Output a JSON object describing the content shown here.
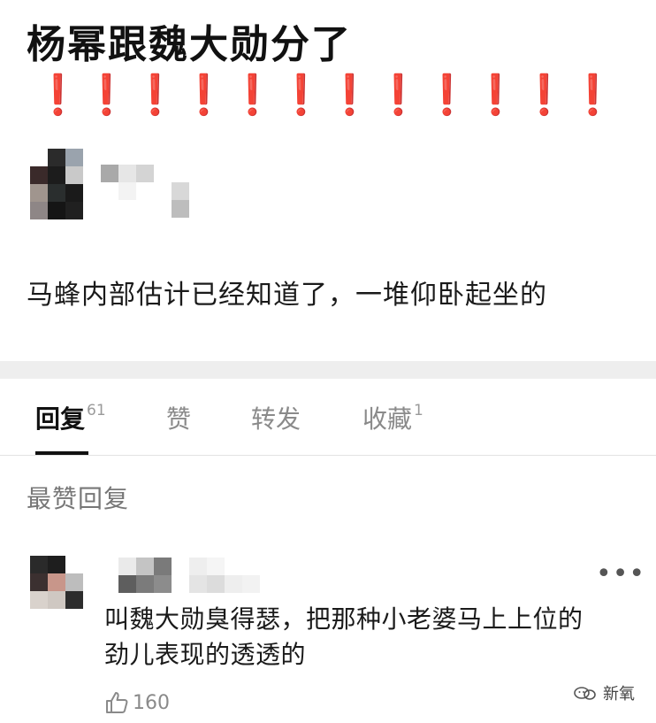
{
  "post": {
    "title": "杨幂跟魏大勋分了",
    "exclamations": [
      "❗",
      "❗",
      "❗",
      "❗",
      "❗",
      "❗",
      "❗",
      "❗",
      "❗",
      "❗",
      "❗",
      "❗"
    ],
    "body": "马蜂内部估计已经知道了，一堆仰卧起坐的"
  },
  "tabs": [
    {
      "label": "回复",
      "count": "61"
    },
    {
      "label": "赞",
      "count": ""
    },
    {
      "label": "转发",
      "count": ""
    },
    {
      "label": "收藏",
      "count": "1"
    }
  ],
  "replies": {
    "section_label": "最赞回复",
    "top_reply": {
      "text_line1": "叫魏大勋臭得瑟，把那种小老婆马上上位的",
      "text_line2": "劲儿表现的透透的",
      "likes": "160",
      "more_label": "•••"
    }
  },
  "watermark": {
    "text": "新氧"
  },
  "colors": {
    "accent_red": "#e8201c",
    "tab_active": "#111111",
    "tab_inactive": "#8a8a8a",
    "divider": "#eeeeee"
  },
  "icons": [
    "exclamation-icon",
    "more-icon",
    "thumbs-up-icon",
    "watermark-logo-icon"
  ]
}
